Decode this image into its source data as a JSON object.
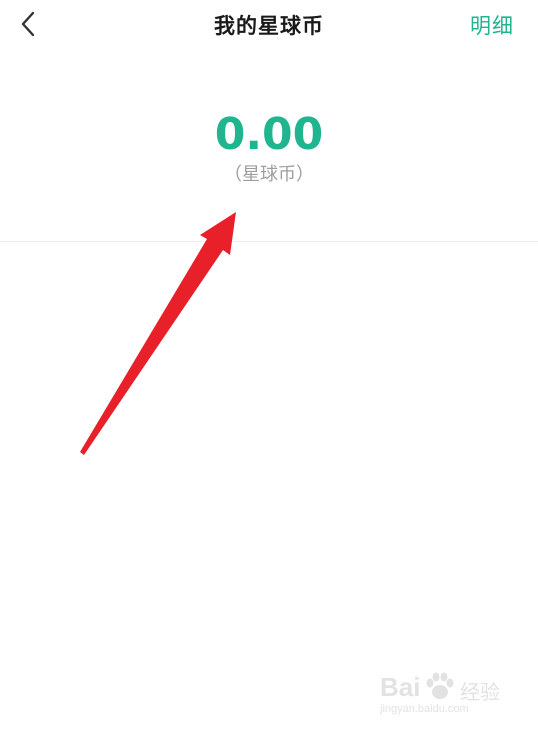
{
  "header": {
    "title": "我的星球币",
    "detail_label": "明细"
  },
  "balance": {
    "amount": "0.00",
    "unit_label": "（星球币）"
  },
  "watermark": {
    "logo_text": "Bai",
    "brand_text": "经验",
    "url_text": "jingyan.baidu.com"
  },
  "colors": {
    "accent": "#1fb58f",
    "title": "#1a1a1a",
    "secondary_text": "#9e9e9e",
    "divider": "#ececec",
    "annotation_arrow": "#e8202a"
  }
}
